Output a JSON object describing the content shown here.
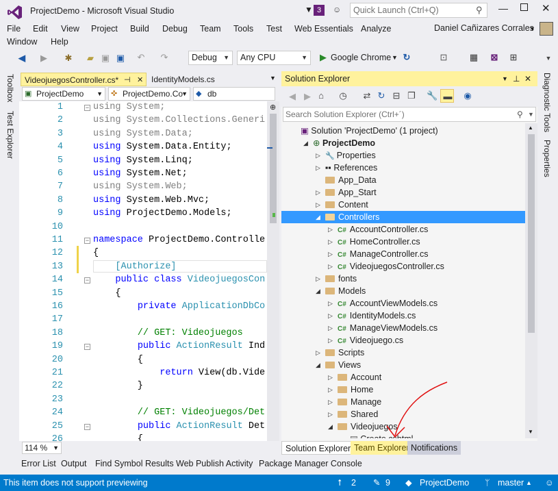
{
  "window": {
    "title": "ProjectDemo - Microsoft Visual Studio",
    "notification_count": "3",
    "quick_launch_placeholder": "Quick Launch (Ctrl+Q)",
    "user": "Daniel Cañizares Corrales"
  },
  "menu": [
    "File",
    "Edit",
    "View",
    "Project",
    "Build",
    "Debug",
    "Team",
    "Tools",
    "Test",
    "Web Essentials",
    "Analyze",
    "Window",
    "Help"
  ],
  "toolbar": {
    "config": "Debug",
    "platform": "Any CPU",
    "browser": "Google Chrome"
  },
  "left_rail": [
    "Toolbox",
    "Test Explorer"
  ],
  "right_rail": [
    "Diagnostic Tools",
    "Properties"
  ],
  "editor": {
    "tabs": [
      "VideojuegosController.cs*",
      "IdentityModels.cs"
    ],
    "nav": [
      "ProjectDemo",
      "ProjectDemo.Co",
      "db"
    ],
    "zoom": "114 %",
    "lines": [
      {
        "n": "1",
        "t": "using System;"
      },
      {
        "n": "2",
        "t": "using System.Collections.Generi"
      },
      {
        "n": "3",
        "t": "using System.Data;"
      },
      {
        "n": "4",
        "t": "using System.Data.Entity;"
      },
      {
        "n": "5",
        "t": "using System.Linq;"
      },
      {
        "n": "6",
        "t": "using System.Net;"
      },
      {
        "n": "7",
        "t": "using System.Web;"
      },
      {
        "n": "8",
        "t": "using System.Web.Mvc;"
      },
      {
        "n": "9",
        "t": "using ProjectDemo.Models;"
      },
      {
        "n": "10",
        "t": ""
      },
      {
        "n": "11",
        "t": "namespace ProjectDemo.Controlle"
      },
      {
        "n": "12",
        "t": "{"
      },
      {
        "n": "13",
        "t": "    [Authorize]"
      },
      {
        "n": "14",
        "t": "    public class VideojuegosCon"
      },
      {
        "n": "15",
        "t": "    {"
      },
      {
        "n": "16",
        "t": "        private ApplicationDbCo"
      },
      {
        "n": "17",
        "t": ""
      },
      {
        "n": "18",
        "t": "        // GET: Videojuegos"
      },
      {
        "n": "19",
        "t": "        public ActionResult Ind"
      },
      {
        "n": "20",
        "t": "        {"
      },
      {
        "n": "21",
        "t": "            return View(db.Vide"
      },
      {
        "n": "22",
        "t": "        }"
      },
      {
        "n": "23",
        "t": ""
      },
      {
        "n": "24",
        "t": "        // GET: Videojuegos/Det"
      },
      {
        "n": "25",
        "t": "        public ActionResult Det"
      },
      {
        "n": "26",
        "t": "        {"
      }
    ]
  },
  "solution_explorer": {
    "title": "Solution Explorer",
    "search_placeholder": "Search Solution Explorer (Ctrl+´)",
    "items": [
      {
        "label": "Solution 'ProjectDemo' (1 project)",
        "kind": "solution"
      },
      {
        "label": "ProjectDemo",
        "kind": "project"
      },
      {
        "label": "Properties",
        "kind": "wrench"
      },
      {
        "label": "References",
        "kind": "refs"
      },
      {
        "label": "App_Data",
        "kind": "folder"
      },
      {
        "label": "App_Start",
        "kind": "folder"
      },
      {
        "label": "Content",
        "kind": "folder"
      },
      {
        "label": "Controllers",
        "kind": "folder-open"
      },
      {
        "label": "AccountController.cs",
        "kind": "cs"
      },
      {
        "label": "HomeController.cs",
        "kind": "cs"
      },
      {
        "label": "ManageController.cs",
        "kind": "cs"
      },
      {
        "label": "VideojuegosController.cs",
        "kind": "cs"
      },
      {
        "label": "fonts",
        "kind": "folder"
      },
      {
        "label": "Models",
        "kind": "folder-open"
      },
      {
        "label": "AccountViewModels.cs",
        "kind": "cs"
      },
      {
        "label": "IdentityModels.cs",
        "kind": "cs"
      },
      {
        "label": "ManageViewModels.cs",
        "kind": "cs"
      },
      {
        "label": "Videojuego.cs",
        "kind": "cs"
      },
      {
        "label": "Scripts",
        "kind": "folder"
      },
      {
        "label": "Views",
        "kind": "folder-open"
      },
      {
        "label": "Account",
        "kind": "folder"
      },
      {
        "label": "Home",
        "kind": "folder"
      },
      {
        "label": "Manage",
        "kind": "folder"
      },
      {
        "label": "Shared",
        "kind": "folder"
      },
      {
        "label": "Videojuegos",
        "kind": "folder-open"
      },
      {
        "label": "Create.cshtml",
        "kind": "file"
      }
    ],
    "tabs": [
      "Solution Explorer",
      "Team Explorer",
      "Notifications"
    ]
  },
  "bottom_tabs": [
    "Error List",
    "Output",
    "Find Symbol Results",
    "Web Publish Activity",
    "Package Manager Console"
  ],
  "status": {
    "message": "This item does not support previewing",
    "up": "2",
    "edits": "9",
    "project": "ProjectDemo",
    "branch": "master"
  },
  "colors": {
    "accent": "#007acc",
    "selected": "#3399ff",
    "se_title": "#fff29d",
    "team_tab": "#fff29d"
  }
}
